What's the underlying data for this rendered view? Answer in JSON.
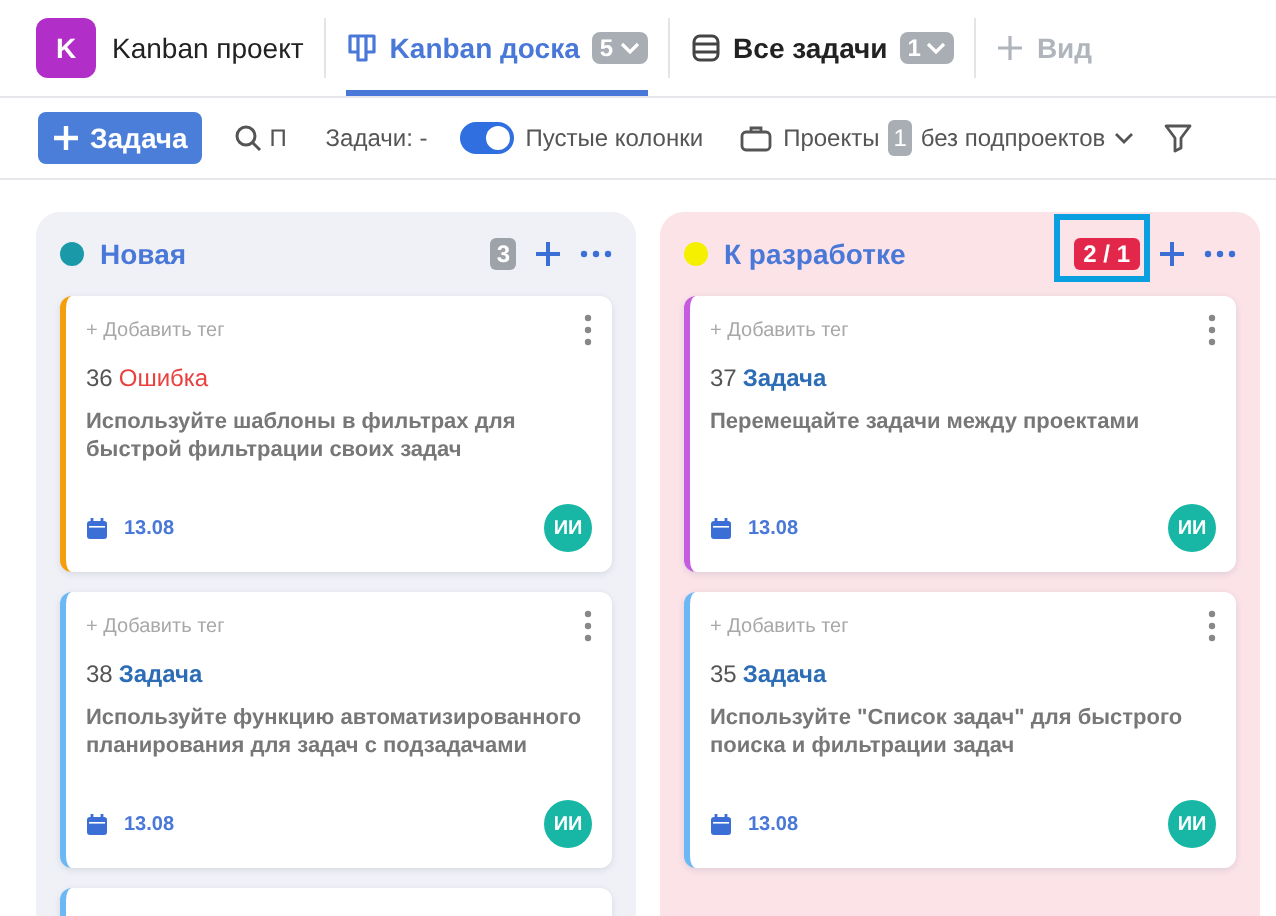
{
  "header": {
    "project_initial": "K",
    "project_name": "Kanban проект",
    "tabs": [
      {
        "label": "Kanban доска",
        "count": "5",
        "selected": true
      },
      {
        "label": "Все задачи",
        "count": "1",
        "selected": false
      }
    ],
    "add_view": "Вид"
  },
  "toolbar": {
    "add_task": "Задача",
    "search_placeholder": "П",
    "tasks_filter": "Задачи: -",
    "empty_columns": {
      "label": "Пустые колонки",
      "on": true
    },
    "projects": {
      "label": "Проекты",
      "count": "1",
      "option": "без подпроектов"
    }
  },
  "columns": [
    {
      "title": "Новая",
      "color": "#1a9aa8",
      "count": "3",
      "over_limit": false,
      "highlighted": false,
      "cards": [
        {
          "tag": "+ Добавить тег",
          "number": "36",
          "kind": "bug",
          "type": "Ошибка",
          "color": "#f59e0b",
          "text": "Используйте шаблоны в фильтрах для быстрой фильтрации своих задач",
          "date": "13.08",
          "assignee": "ИИ"
        },
        {
          "tag": "+ Добавить тег",
          "number": "38",
          "kind": "task",
          "type": "Задача",
          "color": "#6cb8f5",
          "text": "Используйте функцию автоматизированного планирования для задач с подзадачами",
          "date": "13.08",
          "assignee": "ИИ"
        },
        {
          "kind": "stub",
          "color": "#6cb8f5"
        }
      ]
    },
    {
      "title": "К разработке",
      "color": "#f5f000",
      "count": "2 / 1",
      "over_limit": true,
      "highlighted": true,
      "cards": [
        {
          "tag": "+ Добавить тег",
          "number": "37",
          "kind": "task",
          "type": "Задача",
          "color": "#c45be0",
          "text": "Перемещайте задачи между проектами",
          "date": "13.08",
          "assignee": "ИИ"
        },
        {
          "tag": "+ Добавить тег",
          "number": "35",
          "kind": "task",
          "type": "Задача",
          "color": "#6cb8f5",
          "text": "Используйте \"Список задач\" для быстрого поиска и фильтрации задач",
          "date": "13.08",
          "assignee": "ИИ"
        }
      ]
    }
  ]
}
